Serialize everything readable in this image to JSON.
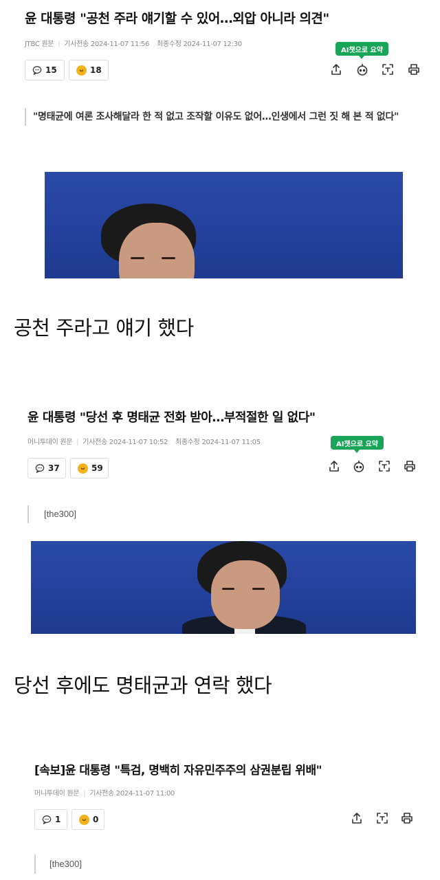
{
  "articles": [
    {
      "headline": "윤 대통령 \"공천 주라 얘기할 수 있어…외압 아니라 의견\"",
      "source": "JTBC 원문",
      "sent_label": "기사전송",
      "sent_time": "2024-11-07 11:56",
      "edited_label": "최종수정",
      "edited_time": "2024-11-07 12:30",
      "comments": "15",
      "reactions": "18",
      "ai_label": "AI챗으로 요약",
      "quote": "\"명태균에 여론 조사해달라 한 적 없고 조작할 이유도 없어…인생에서 그런 짓 해 본 적 없다\"",
      "caption": "공천 주라고 얘기 했다"
    },
    {
      "headline": "윤 대통령 \"당선 후 명태균 전화 받아…부적절한 일 없다\"",
      "source": "머니투데이 원문",
      "sent_label": "기사전송",
      "sent_time": "2024-11-07 10:52",
      "edited_label": "최종수정",
      "edited_time": "2024-11-07 11:05",
      "comments": "37",
      "reactions": "59",
      "ai_label": "AI챗으로 요약",
      "quote": "[the300]",
      "caption": "당선 후에도 명태균과 연락 했다"
    },
    {
      "headline": "[속보]윤 대통령 \"특검, 명백히 자유민주주의 삼권분립 위배\"",
      "source": "머니투데이 원문",
      "sent_label": "기사전송",
      "sent_time": "2024-11-07 11:00",
      "comments": "1",
      "reactions": "0",
      "quote": "[the300]"
    }
  ],
  "icons": {
    "comment": "comment-icon",
    "reaction": "smile-emoji-icon",
    "share": "share-icon",
    "ai_bot": "ai-bot-icon",
    "ocr": "text-scan-icon",
    "print": "print-icon"
  },
  "colors": {
    "ai_badge": "#18a558",
    "photo_background": "#2a4aa8",
    "reaction_emoji": "#f2b21c"
  }
}
